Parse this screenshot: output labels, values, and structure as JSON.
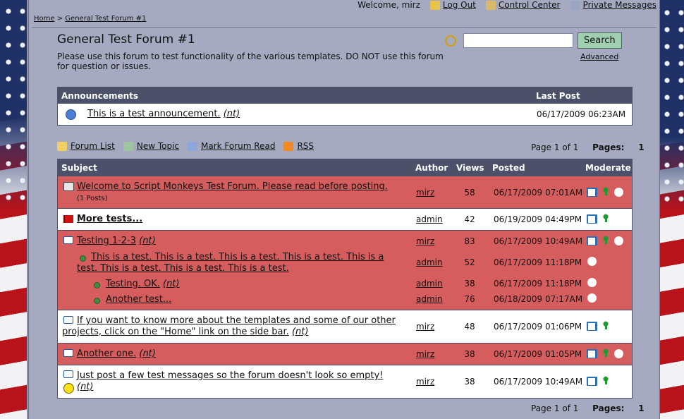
{
  "topbar": {
    "welcome": "Welcome, mirz",
    "logout": "Log Out",
    "control_center": "Control Center",
    "private_messages": "Private Messages"
  },
  "breadcrumb": {
    "home": "Home",
    "sep": ">",
    "forum": "General Test Forum #1"
  },
  "forum": {
    "title": "General Test Forum #1",
    "description": "Please use this forum to test functionality of the various templates. DO NOT use this forum for question or issues."
  },
  "search": {
    "value": "",
    "button": "Search",
    "advanced": "Advanced"
  },
  "announcements": {
    "header": "Announcements",
    "last_post_header": "Last Post",
    "rows": [
      {
        "title": "This is a test announcement.",
        "tag": "(nt)",
        "date": "06/17/2009 06:23AM"
      }
    ]
  },
  "actions": {
    "forum_list": "Forum List",
    "new_topic": "New Topic",
    "mark_read": "Mark Forum Read",
    "rss": "RSS",
    "page_info": "Page 1 of 1",
    "pages_label": "Pages:",
    "pages_value": "1"
  },
  "topics_header": {
    "subject": "Subject",
    "author": "Author",
    "views": "Views",
    "posted": "Posted",
    "moderate": "Moderate"
  },
  "topics": [
    {
      "title": "Welcome to Script Monkeys Test Forum. Please read before posting.",
      "sub": "(1 Posts)",
      "author": "mirz",
      "views": "58",
      "posted": "06/17/2009 07:01AM"
    },
    {
      "title": "More tests...",
      "author": "admin",
      "views": "42",
      "posted": "06/19/2009 04:49PM"
    },
    {
      "title": "Testing 1-2-3",
      "tag": "(nt)",
      "author": "mirz",
      "views": "83",
      "posted": "06/17/2009 10:49AM"
    },
    {
      "title": "This is a test. This is a test. This is a test. This is a test. This is a test. This is a test. This is a test. This is a test.",
      "author": "admin",
      "views": "52",
      "posted": "06/17/2009 11:18PM"
    },
    {
      "title": "Testing. OK.",
      "tag": "(nt)",
      "author": "admin",
      "views": "38",
      "posted": "06/17/2009 11:18PM"
    },
    {
      "title": "Another test...",
      "author": "admin",
      "views": "76",
      "posted": "06/18/2009 07:17AM"
    },
    {
      "title": "If you want to know more about the templates and some of our other projects, click on the \"Home\" link on the side bar.",
      "tag": "(nt)",
      "author": "mirz",
      "views": "48",
      "posted": "06/17/2009 01:06PM"
    },
    {
      "title": "Another one.",
      "tag": "(nt)",
      "author": "mirz",
      "views": "38",
      "posted": "06/17/2009 01:05PM"
    },
    {
      "title": "Just post a few test messages so the forum doesn't look so empty!",
      "tag": "(nt)",
      "author": "mirz",
      "views": "38",
      "posted": "06/17/2009 10:49AM"
    }
  ]
}
